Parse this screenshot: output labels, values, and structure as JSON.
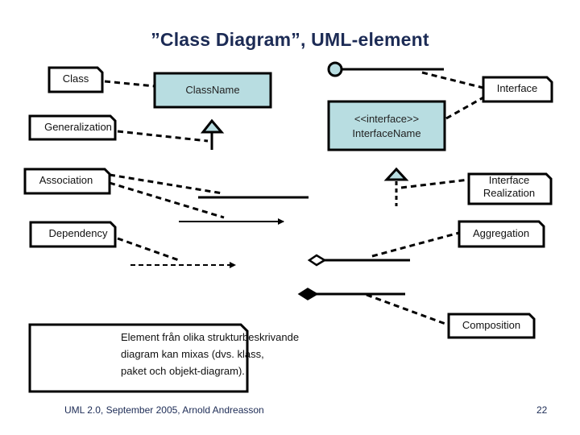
{
  "slide": {
    "title": "”Class Diagram”, UML-element",
    "footer": "UML 2.0, September 2005, Arnold Andreasson",
    "page_number": "22"
  },
  "colors": {
    "class_fill": "#b8dde1",
    "title": "#1c2b55",
    "stroke": "#000000"
  },
  "elements": {
    "class_box": {
      "label": "ClassName"
    },
    "interface_box": {
      "stereotype": "<<interface>>",
      "label": "InterfaceName"
    }
  },
  "notes": {
    "class": [
      "Class"
    ],
    "generalization": [
      "Generalization"
    ],
    "association": [
      "Association"
    ],
    "dependency": [
      "Dependency"
    ],
    "interface": [
      "Interface"
    ],
    "interface_realization": [
      "Interface",
      "Realization"
    ],
    "aggregation": [
      "Aggregation"
    ],
    "composition": [
      "Composition"
    ],
    "mixing": [
      "Element från olika strukturbeskrivande",
      "diagram kan mixas (dvs. klass,",
      "paket och objekt-diagram)."
    ]
  }
}
